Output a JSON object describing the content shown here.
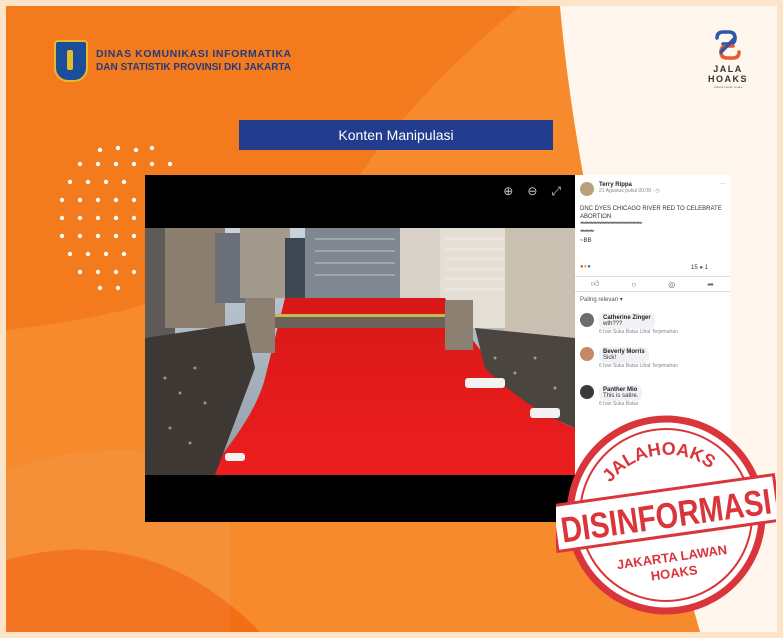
{
  "header": {
    "org_line1": "DINAS KOMUNIKASI INFORMATIKA",
    "org_line2": "DAN STATISTIK PROVINSI DKI JAKARTA"
  },
  "logo": {
    "line1": "JALA",
    "line2": "HOAKS",
    "subtitle": "Jakarta Lawan Hoaks"
  },
  "banner": {
    "label": "Konten Manipulasi"
  },
  "post": {
    "author": "Terry Rippa",
    "time": "21 Agustus pukul 00.08 · ◷",
    "text": "DNC DYES CHICAGO RIVER RED TO CELEBRATE ABORTION",
    "dots1": "**********************************************",
    "dots2": "**********",
    "signoff": "~BB",
    "reaction_count": "15",
    "comment_count": "1",
    "sort_label": "Paling relevan ▾",
    "comments": [
      {
        "name": "Catherine Zinger",
        "text": "wth???",
        "meta": "6 hari   Suka   Balas   Lihat Terjemahan"
      },
      {
        "name": "Beverly Morris",
        "text": "Sick!",
        "meta": "6 hari   Suka   Balas   Lihat Terjemahan"
      },
      {
        "name": "Panther Mio",
        "text": "This is satire.",
        "meta": "6 hari   Suka   Balas"
      }
    ]
  },
  "stamp": {
    "top": "JALAHOAKS",
    "main": "DISINFORMASI",
    "bottom1": "JAKARTA LAWAN",
    "bottom2": "HOAKS"
  },
  "colors": {
    "orange": "#f47b20",
    "navy": "#233d8e",
    "stamp_red": "#d9353b",
    "river_red": "#e01515"
  }
}
